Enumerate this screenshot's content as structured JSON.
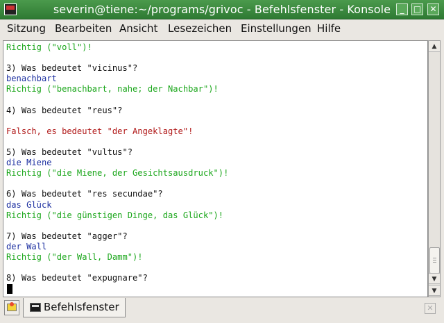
{
  "window": {
    "title": "severin@tiene:~/programs/grivoc - Befehlsfenster - Konsole",
    "minimize_glyph": "_",
    "maximize_glyph": "□",
    "close_glyph": "✕"
  },
  "menu": [
    "Sitzung",
    "Bearbeiten",
    "Ansicht",
    "Lesezeichen",
    "Einstellungen",
    "Hilfe"
  ],
  "terminal": {
    "lines": [
      {
        "text": "Richtig (\"voll\")!",
        "color": "green"
      },
      {
        "text": "",
        "color": "black"
      },
      {
        "text": "3) Was bedeutet \"vicinus\"?",
        "color": "black"
      },
      {
        "text": "benachbart",
        "color": "blue"
      },
      {
        "text": "Richtig (\"benachbart, nahe; der Nachbar\")!",
        "color": "green"
      },
      {
        "text": "",
        "color": "black"
      },
      {
        "text": "4) Was bedeutet \"reus\"?",
        "color": "black"
      },
      {
        "text": "",
        "color": "black"
      },
      {
        "text": "Falsch, es bedeutet \"der Angeklagte\"!",
        "color": "red"
      },
      {
        "text": "",
        "color": "black"
      },
      {
        "text": "5) Was bedeutet \"vultus\"?",
        "color": "black"
      },
      {
        "text": "die Miene",
        "color": "blue"
      },
      {
        "text": "Richtig (\"die Miene, der Gesichtsausdruck\")!",
        "color": "green"
      },
      {
        "text": "",
        "color": "black"
      },
      {
        "text": "6) Was bedeutet \"res secundae\"?",
        "color": "black"
      },
      {
        "text": "das Glück",
        "color": "blue"
      },
      {
        "text": "Richtig (\"die günstigen Dinge, das Glück\")!",
        "color": "green"
      },
      {
        "text": "",
        "color": "black"
      },
      {
        "text": "7) Was bedeutet \"agger\"?",
        "color": "black"
      },
      {
        "text": "der Wall",
        "color": "blue"
      },
      {
        "text": "Richtig (\"der Wall, Damm\")!",
        "color": "green"
      },
      {
        "text": "",
        "color": "black"
      },
      {
        "text": "8) Was bedeutet \"expugnare\"?",
        "color": "black"
      }
    ]
  },
  "scrollbar": {
    "up_glyph": "▲",
    "down_glyph": "▼",
    "position": "bottom"
  },
  "tabs": [
    {
      "label": "Befehlsfenster",
      "icon": "terminal-icon",
      "active": true
    }
  ],
  "new_tab_icon": "new-session-icon",
  "close_tab_glyph": "✕",
  "colors": {
    "titlebar": "#3a8a3e",
    "green_text": "#1aa61a",
    "blue_text": "#1c2fa0",
    "red_text": "#b01818"
  }
}
